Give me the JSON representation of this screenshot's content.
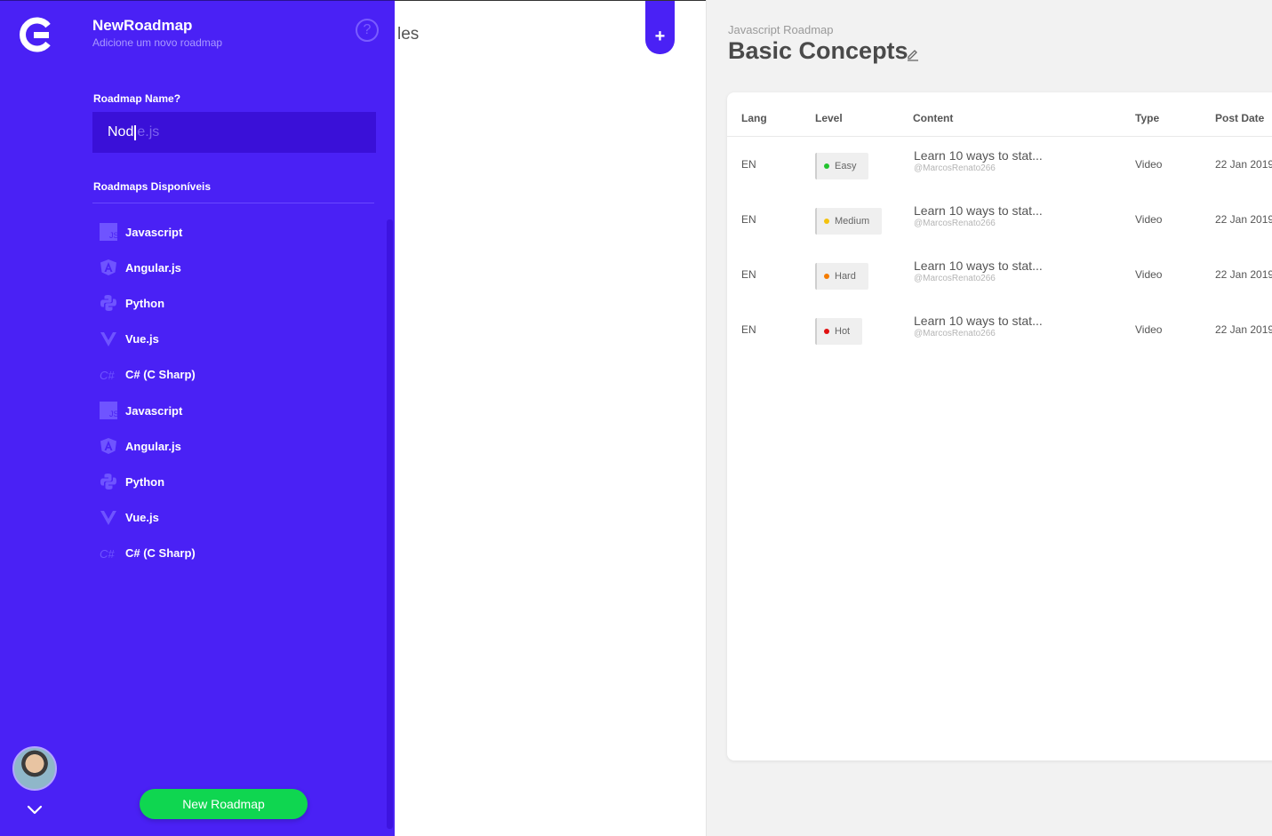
{
  "sidebar": {
    "app_title": "NewRoadmap",
    "app_subtitle": "Adicione um novo roadmap",
    "help_label": "?",
    "field_label": "Roadmap Name?",
    "input_typed": "Nod",
    "input_suggestion": "e.js",
    "section_label": "Roadmaps Disponíveis",
    "items": [
      {
        "label": "Javascript",
        "icon": "javascript-icon"
      },
      {
        "label": "Angular.js",
        "icon": "angular-icon"
      },
      {
        "label": "Python",
        "icon": "python-icon"
      },
      {
        "label": "Vue.js",
        "icon": "vue-icon"
      },
      {
        "label": "C# (C Sharp)",
        "icon": "csharp-icon"
      },
      {
        "label": "Javascript",
        "icon": "javascript-icon"
      },
      {
        "label": "Angular.js",
        "icon": "angular-icon"
      },
      {
        "label": "Python",
        "icon": "python-icon"
      },
      {
        "label": "Vue.js",
        "icon": "vue-icon"
      },
      {
        "label": "C# (C Sharp)",
        "icon": "csharp-icon"
      }
    ],
    "new_roadmap_button": "New Roadmap"
  },
  "middle": {
    "partial_text": "les",
    "plus_label": "+"
  },
  "main": {
    "breadcrumb": "Javascript Roadmap",
    "title": "Basic Concepts",
    "table": {
      "headers": [
        "Lang",
        "Level",
        "Content",
        "Type",
        "Post Date"
      ],
      "rows": [
        {
          "lang": "EN",
          "level": "Easy",
          "level_color": "#22c32e",
          "content": "Learn 10 ways to stat...",
          "author": "@MarcosRenato266",
          "type": "Video",
          "date": "22 Jan 2019"
        },
        {
          "lang": "EN",
          "level": "Medium",
          "level_color": "#f4c20d",
          "content": "Learn 10 ways to stat...",
          "author": "@MarcosRenato266",
          "type": "Video",
          "date": "22 Jan 2019"
        },
        {
          "lang": "EN",
          "level": "Hard",
          "level_color": "#f57c00",
          "content": "Learn 10 ways to stat...",
          "author": "@MarcosRenato266",
          "type": "Video",
          "date": "22 Jan 2019"
        },
        {
          "lang": "EN",
          "level": "Hot",
          "level_color": "#e01010",
          "content": "Learn 10 ways to stat...",
          "author": "@MarcosRenato266",
          "type": "Video",
          "date": "22 Jan 2019"
        }
      ]
    }
  },
  "colors": {
    "sidebar_bg": "#4a21f5",
    "accent_green": "#0fd650"
  }
}
